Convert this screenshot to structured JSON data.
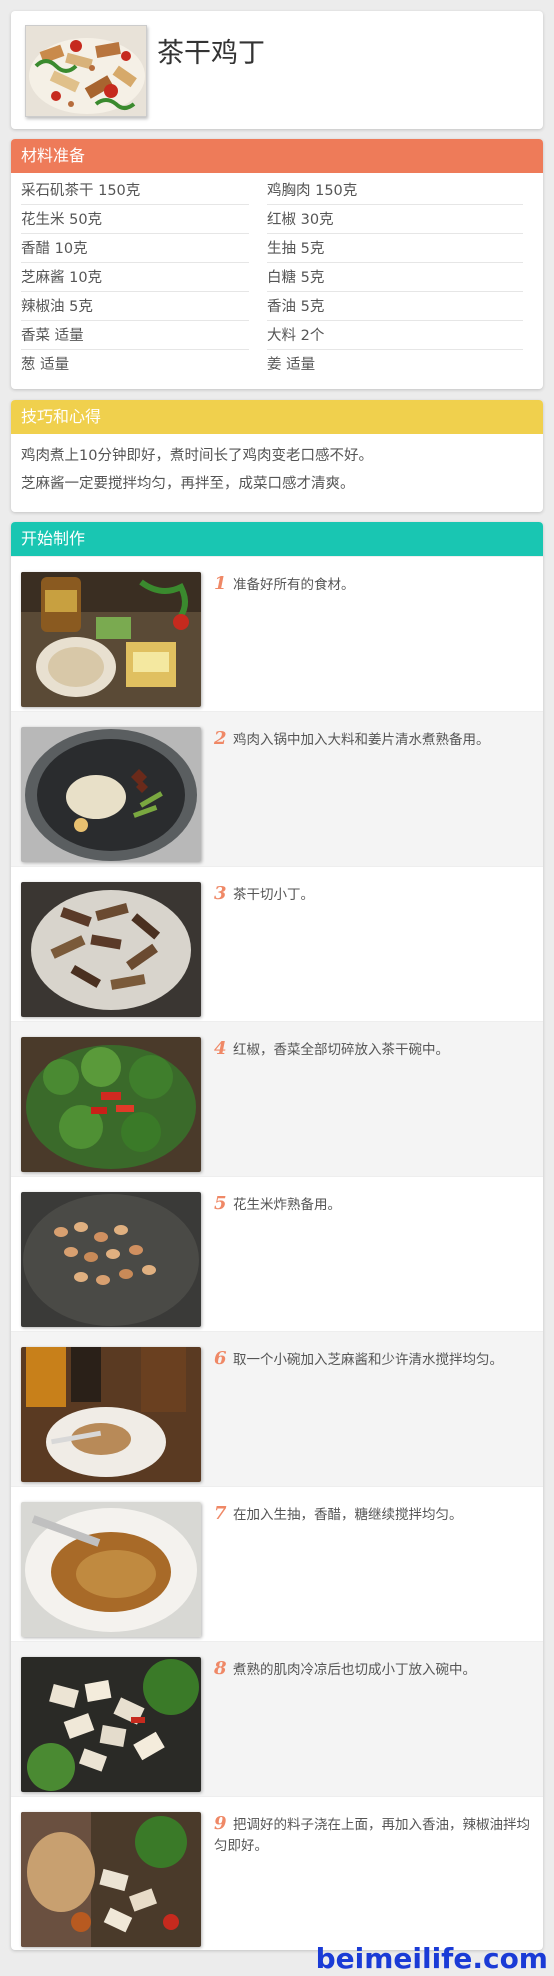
{
  "header": {
    "title": "茶干鸡丁",
    "thumb_icon": "dish-photo"
  },
  "colors": {
    "ingredients_header": "#ee7b59",
    "tips_header": "#f0d04d",
    "steps_header": "#19c6b2",
    "step_number": "#ef8866",
    "watermark": "#1a3bd6"
  },
  "ingredients": {
    "heading": "材料准备",
    "rows": [
      {
        "left": "采石矶茶干  150克",
        "right": "鸡胸肉  150克"
      },
      {
        "left": "花生米  50克",
        "right": "红椒  30克"
      },
      {
        "left": "香醋  10克",
        "right": "生抽  5克"
      },
      {
        "left": "芝麻酱  10克",
        "right": "白糖  5克"
      },
      {
        "left": "辣椒油  5克",
        "right": "香油  5克"
      },
      {
        "left": "香菜  适量",
        "right": "大料  2个"
      },
      {
        "left": "葱  适量",
        "right": "姜  适量"
      }
    ]
  },
  "tips": {
    "heading": "技巧和心得",
    "lines": [
      "鸡肉煮上10分钟即好，煮时间长了鸡肉变老口感不好。",
      "芝麻酱一定要搅拌均匀，再拌至，成菜口感才清爽。"
    ]
  },
  "steps": {
    "heading": "开始制作",
    "items": [
      {
        "num": "1",
        "text": "准备好所有的食材。",
        "photo": "ingredients-photo"
      },
      {
        "num": "2",
        "text": "鸡肉入锅中加入大料和姜片清水煮熟备用。",
        "photo": "boiling-chicken-photo"
      },
      {
        "num": "3",
        "text": "茶干切小丁。",
        "photo": "diced-tofu-photo"
      },
      {
        "num": "4",
        "text": "红椒，香菜全部切碎放入茶干碗中。",
        "photo": "cilantro-pepper-photo"
      },
      {
        "num": "5",
        "text": "花生米炸熟备用。",
        "photo": "fried-peanuts-photo"
      },
      {
        "num": "6",
        "text": "取一个小碗加入芝麻酱和少许清水搅拌均匀。",
        "photo": "sesame-paste-photo"
      },
      {
        "num": "7",
        "text": "在加入生抽，香醋，糖继续搅拌均匀。",
        "photo": "sauce-bowl-photo"
      },
      {
        "num": "8",
        "text": "煮熟的肌肉冷凉后也切成小丁放入碗中。",
        "photo": "diced-chicken-photo"
      },
      {
        "num": "9",
        "text": "把调好的料子浇在上面，再加入香油，辣椒油拌均匀即好。",
        "photo": "finished-dish-photo"
      }
    ]
  },
  "watermark": "beimeilife.com"
}
